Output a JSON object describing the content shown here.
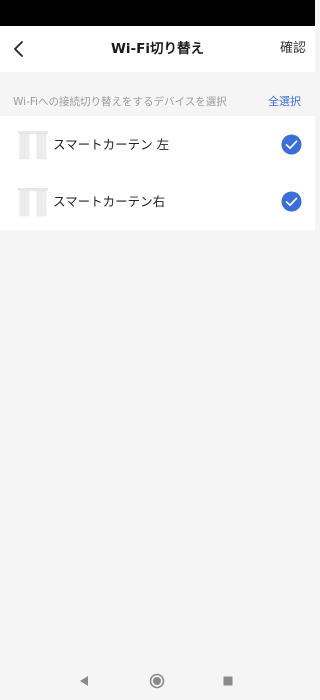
{
  "header": {
    "title": "Wi-Fi切り替え",
    "confirm_label": "確認",
    "back_icon": "chevron-left-icon"
  },
  "section": {
    "hint": "Wi-Fiへの接続切り替えをするデバイスを選択",
    "select_all_label": "全選択"
  },
  "devices": [
    {
      "label": "スマートカーテン 左",
      "icon": "curtain-icon",
      "selected": true
    },
    {
      "label": "スマートカーテン右",
      "icon": "curtain-icon",
      "selected": true
    }
  ],
  "colors": {
    "accent": "#3c6fd6",
    "background": "#f5f5f5",
    "hint_text": "#9a9a9a"
  },
  "nav": {
    "icons": [
      "back-triangle-icon",
      "home-circle-icon",
      "recents-square-icon"
    ]
  }
}
